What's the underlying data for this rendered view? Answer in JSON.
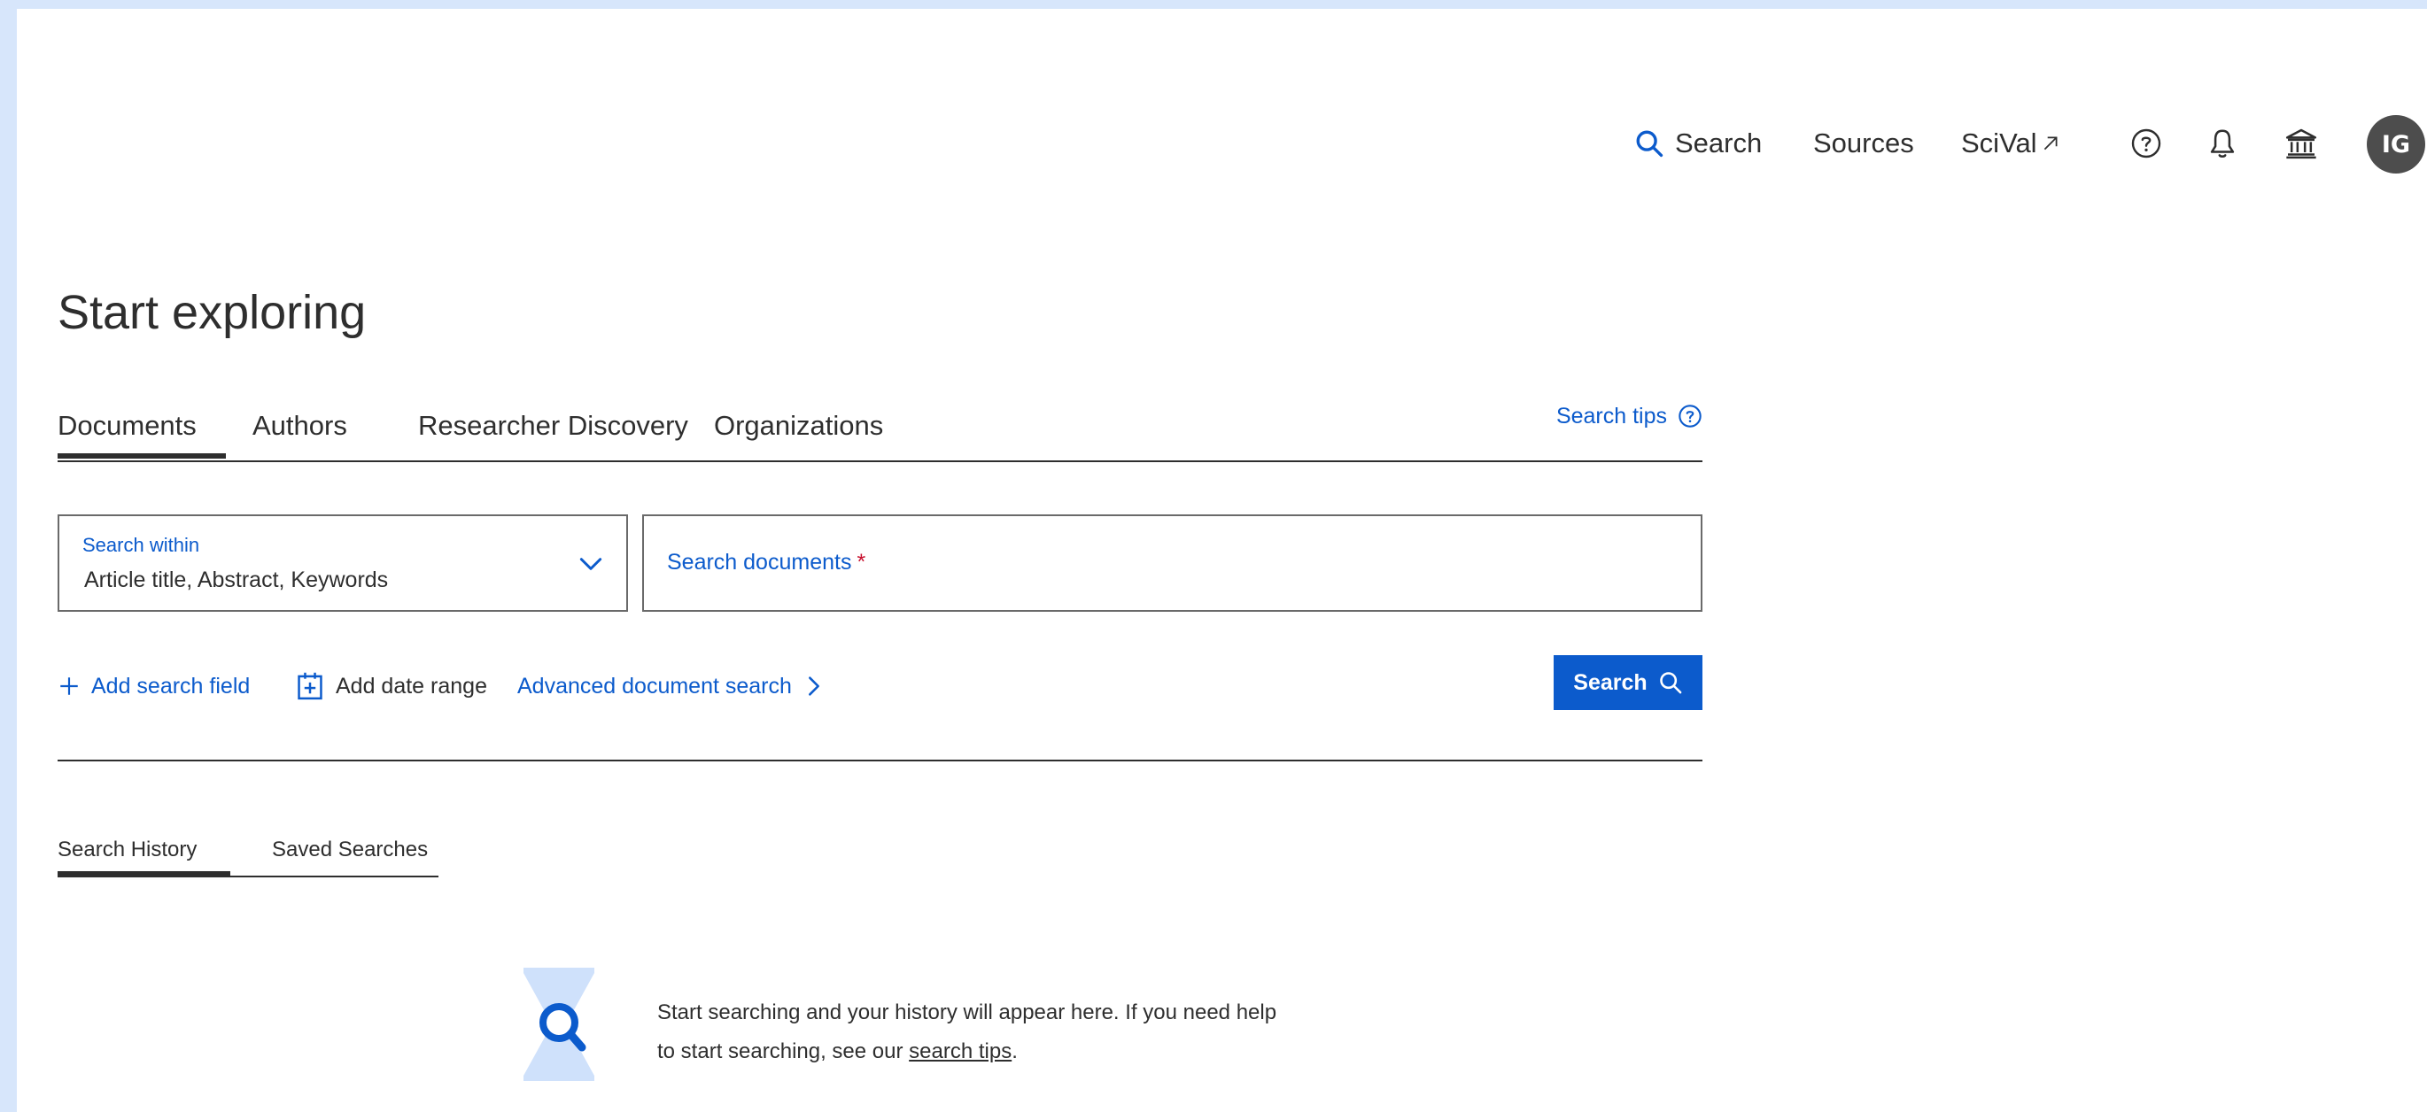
{
  "nav": {
    "search_label": "Search",
    "sources_label": "Sources",
    "scival_label": "SciVal",
    "avatar_initials": "IG"
  },
  "page": {
    "title": "Start exploring"
  },
  "tabs": [
    {
      "label": "Documents",
      "active": true
    },
    {
      "label": "Authors",
      "active": false
    },
    {
      "label": "Researcher Discovery",
      "active": false
    },
    {
      "label": "Organizations",
      "active": false
    }
  ],
  "search_tips_label": "Search tips",
  "search_within": {
    "label": "Search within",
    "value": "Article title, Abstract, Keywords"
  },
  "document_search": {
    "placeholder": "Search documents",
    "required_marker": "*",
    "value": ""
  },
  "actions": {
    "add_field": "Add search field",
    "add_date": "Add date range",
    "advanced": "Advanced document search",
    "search_button": "Search"
  },
  "history_tabs": [
    {
      "label": "Search History",
      "active": true
    },
    {
      "label": "Saved Searches",
      "active": false
    }
  ],
  "empty_state": {
    "text": "Start searching and your history will appear here. If you need help to start searching, see our ",
    "link": "search tips",
    "suffix": "."
  },
  "colors": {
    "accent": "#0c5bcc",
    "background": "#d7e6fb",
    "text": "#2e2e2e",
    "required": "#c8102e"
  }
}
